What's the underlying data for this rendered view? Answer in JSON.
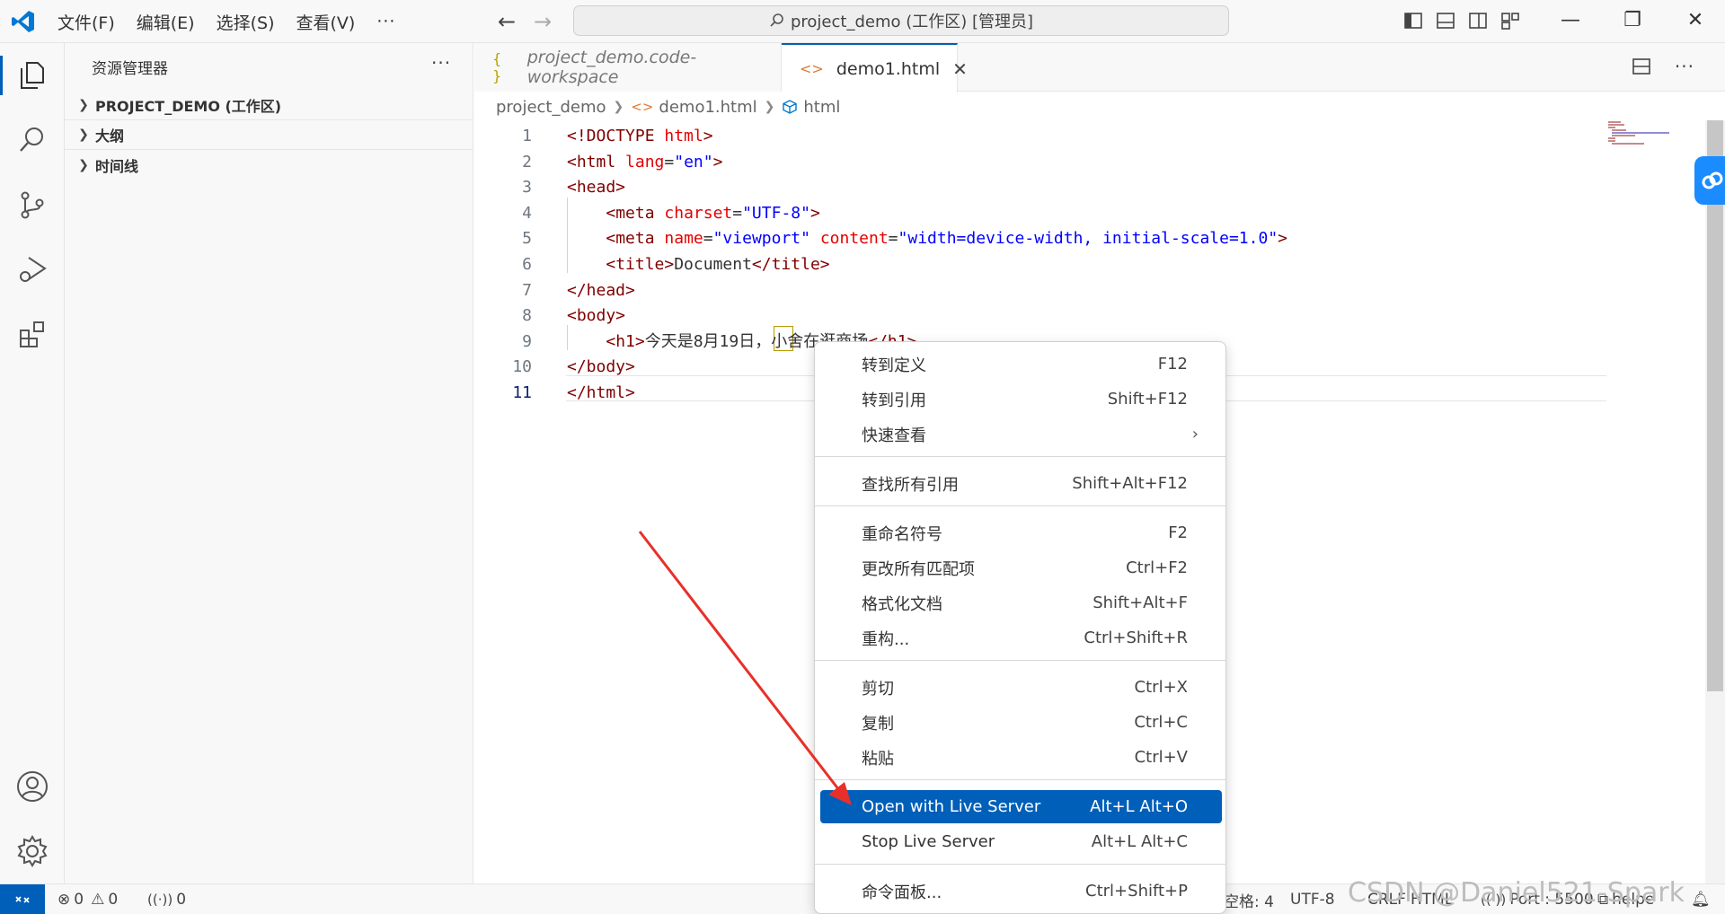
{
  "titlebar": {
    "menus": [
      "文件(F)",
      "编辑(E)",
      "选择(S)",
      "查看(V)"
    ],
    "more": "···",
    "back": "←",
    "forward": "→",
    "command_center": "project_demo (工作区) [管理员]",
    "minimize": "—",
    "restore": "❐",
    "close": "✕"
  },
  "sidebar": {
    "title": "资源管理器",
    "more": "···",
    "sections": [
      "PROJECT_DEMO (工作区)",
      "大纲",
      "时间线"
    ]
  },
  "tabs": [
    {
      "label": "project_demo.code-workspace",
      "icon": "{ }",
      "active": false
    },
    {
      "label": "demo1.html",
      "icon": "<>",
      "active": true,
      "close": "✕"
    }
  ],
  "editor_actions": {
    "more": "···"
  },
  "breadcrumb": [
    "project_demo",
    "demo1.html",
    "html"
  ],
  "code_lines": [
    {
      "n": "1",
      "tokens": [
        [
          "t-tag",
          "<!DOCTYPE "
        ],
        [
          "t-attr",
          "html"
        ],
        [
          "t-tag",
          ">"
        ]
      ]
    },
    {
      "n": "2",
      "tokens": [
        [
          "t-tag",
          "<html "
        ],
        [
          "t-attr",
          "lang"
        ],
        [
          "t-txt",
          "="
        ],
        [
          "t-val",
          "\"en\""
        ],
        [
          "t-tag",
          ">"
        ]
      ]
    },
    {
      "n": "3",
      "tokens": [
        [
          "t-tag",
          "<head>"
        ]
      ]
    },
    {
      "n": "4",
      "tokens": [
        [
          "t-txt",
          "    "
        ],
        [
          "t-tag",
          "<meta "
        ],
        [
          "t-attr",
          "charset"
        ],
        [
          "t-txt",
          "="
        ],
        [
          "t-val",
          "\"UTF-8\""
        ],
        [
          "t-tag",
          ">"
        ]
      ]
    },
    {
      "n": "5",
      "tokens": [
        [
          "t-txt",
          "    "
        ],
        [
          "t-tag",
          "<meta "
        ],
        [
          "t-attr",
          "name"
        ],
        [
          "t-txt",
          "="
        ],
        [
          "t-val",
          "\"viewport\" "
        ],
        [
          "t-attr",
          "content"
        ],
        [
          "t-txt",
          "="
        ],
        [
          "t-val",
          "\"width=device-width, initial-scale=1.0\""
        ],
        [
          "t-tag",
          ">"
        ]
      ]
    },
    {
      "n": "6",
      "tokens": [
        [
          "t-txt",
          "    "
        ],
        [
          "t-tag",
          "<title>"
        ],
        [
          "t-txt",
          "Document"
        ],
        [
          "t-tag",
          "</title>"
        ]
      ]
    },
    {
      "n": "7",
      "tokens": [
        [
          "t-tag",
          "</head>"
        ]
      ]
    },
    {
      "n": "8",
      "tokens": [
        [
          "t-tag",
          "<body>"
        ]
      ]
    },
    {
      "n": "9",
      "tokens": [
        [
          "t-txt",
          "    "
        ],
        [
          "t-tag",
          "<h1>"
        ],
        [
          "t-txt",
          "今天是8月19日，小舍在逛商场"
        ],
        [
          "t-tag",
          "</h1>"
        ]
      ]
    },
    {
      "n": "10",
      "tokens": [
        [
          "t-tag",
          "</body>"
        ]
      ]
    },
    {
      "n": "11",
      "tokens": [
        [
          "t-tag",
          "</html>"
        ]
      ]
    }
  ],
  "context_menu": [
    {
      "label": "转到定义",
      "key": "F12"
    },
    {
      "label": "转到引用",
      "key": "Shift+F12"
    },
    {
      "label": "快速查看",
      "key": "",
      "submenu": "›"
    },
    {
      "sep": true
    },
    {
      "label": "查找所有引用",
      "key": "Shift+Alt+F12"
    },
    {
      "sep": true
    },
    {
      "label": "重命名符号",
      "key": "F2"
    },
    {
      "label": "更改所有匹配项",
      "key": "Ctrl+F2"
    },
    {
      "label": "格式化文档",
      "key": "Shift+Alt+F"
    },
    {
      "label": "重构...",
      "key": "Ctrl+Shift+R"
    },
    {
      "sep": true
    },
    {
      "label": "剪切",
      "key": "Ctrl+X"
    },
    {
      "label": "复制",
      "key": "Ctrl+C"
    },
    {
      "label": "粘贴",
      "key": "Ctrl+V"
    },
    {
      "sep": true
    },
    {
      "label": "Open with Live Server",
      "key": "Alt+L Alt+O",
      "highlighted": true
    },
    {
      "label": "Stop Live Server",
      "key": "Alt+L Alt+C"
    },
    {
      "sep": true
    },
    {
      "label": "命令面板...",
      "key": "Ctrl+Shift+P"
    }
  ],
  "statusbar": {
    "errors": "0",
    "warnings": "0",
    "ports": "0",
    "spaces": "空格: 4",
    "encoding": "UTF-8",
    "eol": "CRLF",
    "language": "HTML",
    "port": "Port : 5500",
    "helper": "helpe",
    "watermark": "CSDN @Daniel521-Spark"
  },
  "colors": {
    "accent": "#005fb8",
    "tag": "#800000",
    "attr": "#e50000",
    "value": "#0000ff",
    "arrow": "#e8302a"
  }
}
